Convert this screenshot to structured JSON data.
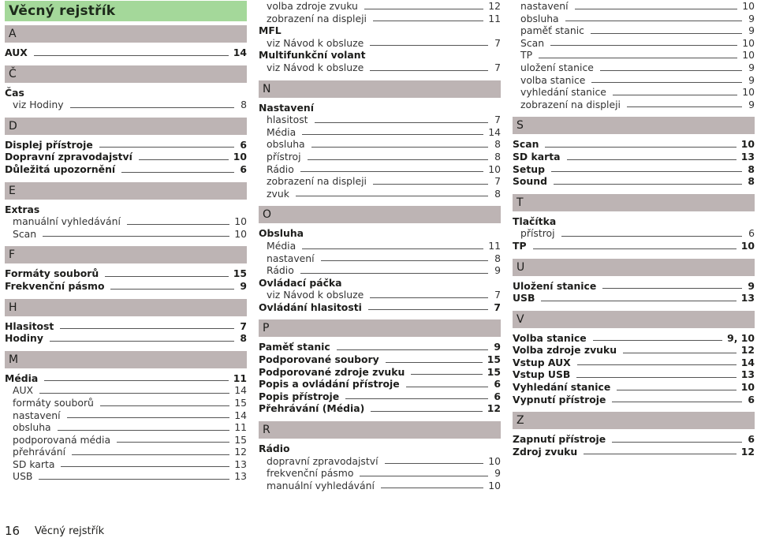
{
  "title": "Věcný rejstřík",
  "footer": {
    "page_number": "16",
    "section": "Věcný rejstřík"
  },
  "columns": [
    {
      "blocks": [
        {
          "type": "letter",
          "label": "A"
        },
        {
          "type": "entry",
          "level": "main",
          "text": "AUX",
          "page": "14"
        },
        {
          "type": "letter",
          "label": "Č"
        },
        {
          "type": "heading",
          "level": "main",
          "text": "Čas"
        },
        {
          "type": "entry",
          "level": "sub",
          "text": "viz Hodiny",
          "page": "8"
        },
        {
          "type": "letter",
          "label": "D"
        },
        {
          "type": "entry",
          "level": "main",
          "text": "Displej přístroje",
          "page": "6"
        },
        {
          "type": "entry",
          "level": "main",
          "text": "Dopravní zpravodajství",
          "page": "10"
        },
        {
          "type": "entry",
          "level": "main",
          "text": "Důležitá upozornění",
          "page": "6"
        },
        {
          "type": "letter",
          "label": "E"
        },
        {
          "type": "heading",
          "level": "main",
          "text": "Extras"
        },
        {
          "type": "entry",
          "level": "sub",
          "text": "manuální vyhledávání",
          "page": "10"
        },
        {
          "type": "entry",
          "level": "sub",
          "text": "Scan",
          "page": "10"
        },
        {
          "type": "letter",
          "label": "F"
        },
        {
          "type": "entry",
          "level": "main",
          "text": "Formáty souborů",
          "page": "15"
        },
        {
          "type": "entry",
          "level": "main",
          "text": "Frekvenční pásmo",
          "page": "9"
        },
        {
          "type": "letter",
          "label": "H"
        },
        {
          "type": "entry",
          "level": "main",
          "text": "Hlasitost",
          "page": "7"
        },
        {
          "type": "entry",
          "level": "main",
          "text": "Hodiny",
          "page": "8"
        },
        {
          "type": "letter",
          "label": "M"
        },
        {
          "type": "entry",
          "level": "main",
          "text": "Média",
          "page": "11"
        },
        {
          "type": "entry",
          "level": "sub",
          "text": "AUX",
          "page": "14"
        },
        {
          "type": "entry",
          "level": "sub",
          "text": "formáty souborů",
          "page": "15"
        },
        {
          "type": "entry",
          "level": "sub",
          "text": "nastavení",
          "page": "14"
        },
        {
          "type": "entry",
          "level": "sub",
          "text": "obsluha",
          "page": "11"
        },
        {
          "type": "entry",
          "level": "sub",
          "text": "podporovaná média",
          "page": "15"
        },
        {
          "type": "entry",
          "level": "sub",
          "text": "přehrávání",
          "page": "12"
        },
        {
          "type": "entry",
          "level": "sub",
          "text": "SD karta",
          "page": "13"
        },
        {
          "type": "entry",
          "level": "sub",
          "text": "USB",
          "page": "13"
        }
      ]
    },
    {
      "blocks": [
        {
          "type": "entry",
          "level": "sub",
          "text": "volba zdroje zvuku",
          "page": "12"
        },
        {
          "type": "entry",
          "level": "sub",
          "text": "zobrazení na displeji",
          "page": "11"
        },
        {
          "type": "heading",
          "level": "main",
          "text": "MFL"
        },
        {
          "type": "entry",
          "level": "sub",
          "text": "viz Návod k obsluze",
          "page": "7"
        },
        {
          "type": "heading",
          "level": "main",
          "text": "Multifunkční volant"
        },
        {
          "type": "entry",
          "level": "sub",
          "text": "viz Návod k obsluze",
          "page": "7"
        },
        {
          "type": "letter",
          "label": "N"
        },
        {
          "type": "heading",
          "level": "main",
          "text": "Nastavení"
        },
        {
          "type": "entry",
          "level": "sub",
          "text": "hlasitost",
          "page": "7"
        },
        {
          "type": "entry",
          "level": "sub",
          "text": "Média",
          "page": "14"
        },
        {
          "type": "entry",
          "level": "sub",
          "text": "obsluha",
          "page": "8"
        },
        {
          "type": "entry",
          "level": "sub",
          "text": "přístroj",
          "page": "8"
        },
        {
          "type": "entry",
          "level": "sub",
          "text": "Rádio",
          "page": "10"
        },
        {
          "type": "entry",
          "level": "sub",
          "text": "zobrazení na displeji",
          "page": "7"
        },
        {
          "type": "entry",
          "level": "sub",
          "text": "zvuk",
          "page": "8"
        },
        {
          "type": "letter",
          "label": "O"
        },
        {
          "type": "heading",
          "level": "main",
          "text": "Obsluha"
        },
        {
          "type": "entry",
          "level": "sub",
          "text": "Média",
          "page": "11"
        },
        {
          "type": "entry",
          "level": "sub",
          "text": "nastavení",
          "page": "8"
        },
        {
          "type": "entry",
          "level": "sub",
          "text": "Rádio",
          "page": "9"
        },
        {
          "type": "heading",
          "level": "main",
          "text": "Ovládací páčka"
        },
        {
          "type": "entry",
          "level": "sub",
          "text": "viz Návod k obsluze",
          "page": "7"
        },
        {
          "type": "entry",
          "level": "main",
          "text": "Ovládání hlasitosti",
          "page": "7"
        },
        {
          "type": "letter",
          "label": "P"
        },
        {
          "type": "entry",
          "level": "main",
          "text": "Paměť stanic",
          "page": "9"
        },
        {
          "type": "entry",
          "level": "main",
          "text": "Podporované soubory",
          "page": "15"
        },
        {
          "type": "entry",
          "level": "main",
          "text": "Podporované zdroje zvuku",
          "page": "15"
        },
        {
          "type": "entry",
          "level": "main",
          "text": "Popis a ovládání přístroje",
          "page": "6"
        },
        {
          "type": "entry",
          "level": "main",
          "text": "Popis přístroje",
          "page": "6"
        },
        {
          "type": "entry",
          "level": "main",
          "text": "Přehrávání (Média)",
          "page": "12"
        },
        {
          "type": "letter",
          "label": "R"
        },
        {
          "type": "heading",
          "level": "main",
          "text": "Rádio"
        },
        {
          "type": "entry",
          "level": "sub",
          "text": "dopravní zpravodajství",
          "page": "10"
        },
        {
          "type": "entry",
          "level": "sub",
          "text": "frekvenční pásmo",
          "page": "9"
        },
        {
          "type": "entry",
          "level": "sub",
          "text": "manuální vyhledávání",
          "page": "10"
        }
      ]
    },
    {
      "blocks": [
        {
          "type": "entry",
          "level": "sub",
          "text": "nastavení",
          "page": "10"
        },
        {
          "type": "entry",
          "level": "sub",
          "text": "obsluha",
          "page": "9"
        },
        {
          "type": "entry",
          "level": "sub",
          "text": "paměť stanic",
          "page": "9"
        },
        {
          "type": "entry",
          "level": "sub",
          "text": "Scan",
          "page": "10"
        },
        {
          "type": "entry",
          "level": "sub",
          "text": "TP",
          "page": "10"
        },
        {
          "type": "entry",
          "level": "sub",
          "text": "uložení stanice",
          "page": "9"
        },
        {
          "type": "entry",
          "level": "sub",
          "text": "volba stanice",
          "page": "9"
        },
        {
          "type": "entry",
          "level": "sub",
          "text": "vyhledání stanice",
          "page": "10"
        },
        {
          "type": "entry",
          "level": "sub",
          "text": "zobrazení na displeji",
          "page": "9"
        },
        {
          "type": "letter",
          "label": "S"
        },
        {
          "type": "entry",
          "level": "main",
          "text": "Scan",
          "page": "10"
        },
        {
          "type": "entry",
          "level": "main",
          "text": "SD karta",
          "page": "13"
        },
        {
          "type": "entry",
          "level": "main",
          "text": "Setup",
          "page": "8"
        },
        {
          "type": "entry",
          "level": "main",
          "text": "Sound",
          "page": "8"
        },
        {
          "type": "letter",
          "label": "T"
        },
        {
          "type": "heading",
          "level": "main",
          "text": "Tlačítka"
        },
        {
          "type": "entry",
          "level": "sub",
          "text": "přístroj",
          "page": "6"
        },
        {
          "type": "entry",
          "level": "main",
          "text": "TP",
          "page": "10"
        },
        {
          "type": "letter",
          "label": "U"
        },
        {
          "type": "entry",
          "level": "main",
          "text": "Uložení stanice",
          "page": "9"
        },
        {
          "type": "entry",
          "level": "main",
          "text": "USB",
          "page": "13"
        },
        {
          "type": "letter",
          "label": "V"
        },
        {
          "type": "entry",
          "level": "main",
          "text": "Volba stanice",
          "page": "9, 10"
        },
        {
          "type": "entry",
          "level": "main",
          "text": "Volba zdroje zvuku",
          "page": "12"
        },
        {
          "type": "entry",
          "level": "main",
          "text": "Vstup AUX",
          "page": "14"
        },
        {
          "type": "entry",
          "level": "main",
          "text": "Vstup USB",
          "page": "13"
        },
        {
          "type": "entry",
          "level": "main",
          "text": "Vyhledání stanice",
          "page": "10"
        },
        {
          "type": "entry",
          "level": "main",
          "text": "Vypnutí přístroje",
          "page": "6"
        },
        {
          "type": "letter",
          "label": "Z"
        },
        {
          "type": "entry",
          "level": "main",
          "text": "Zapnutí přístroje",
          "page": "6"
        },
        {
          "type": "entry",
          "level": "main",
          "text": "Zdroj zvuku",
          "page": "12"
        }
      ]
    }
  ]
}
